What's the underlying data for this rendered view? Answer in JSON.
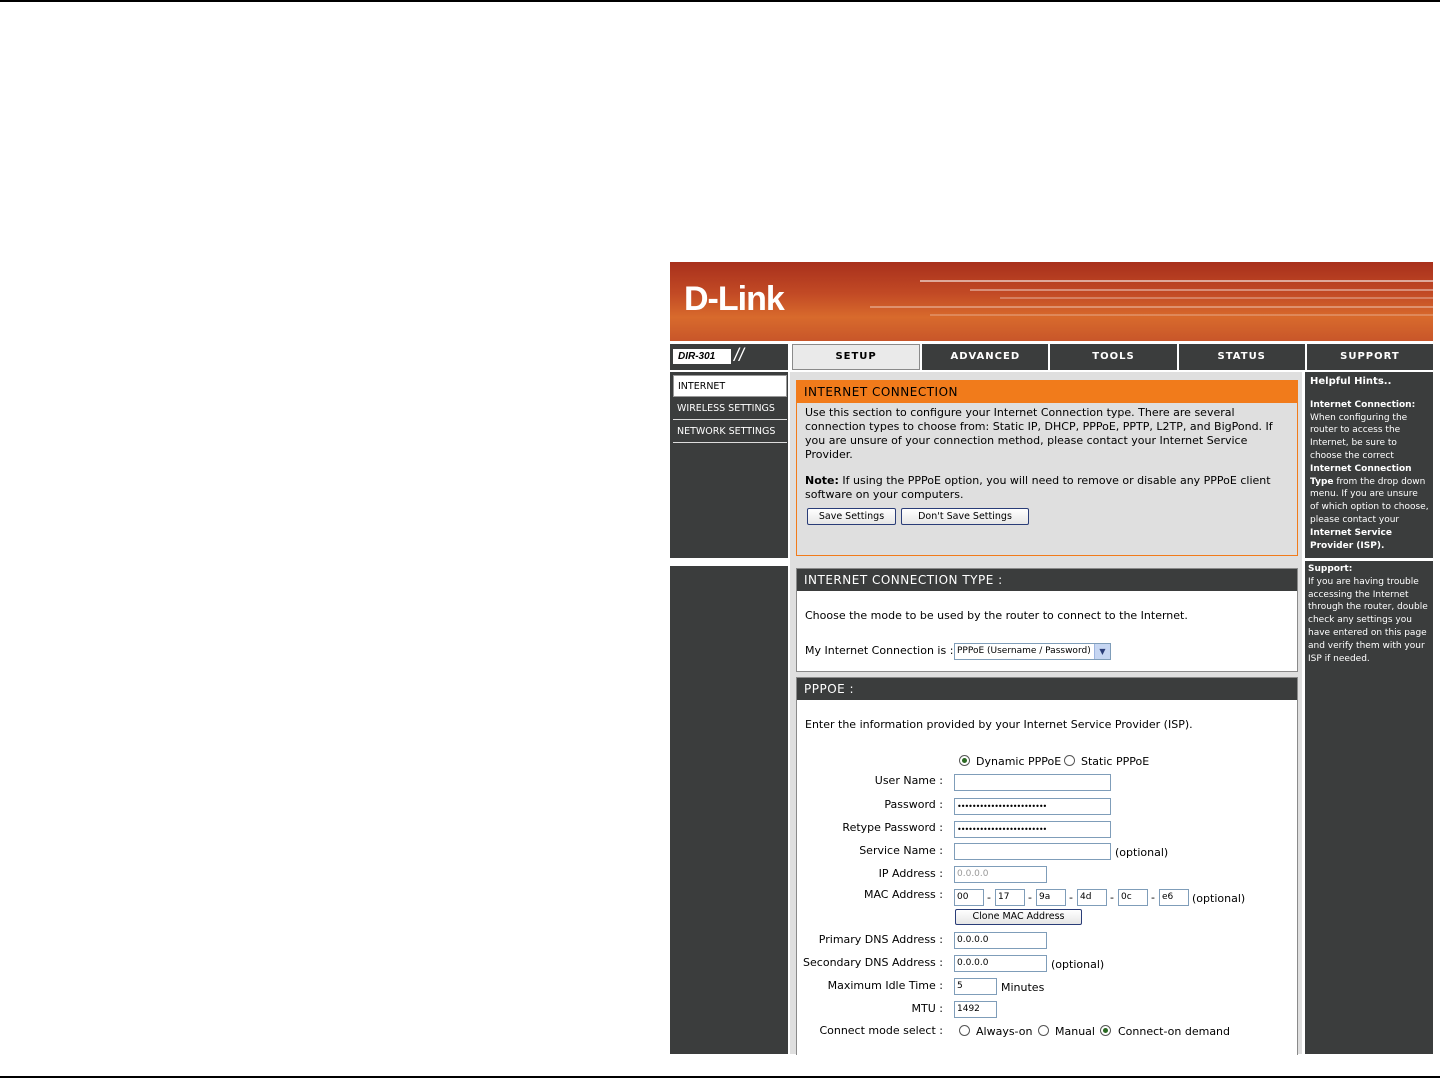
{
  "brand": {
    "logo": "D-Link",
    "model": "DIR-301"
  },
  "tabs": [
    "SETUP",
    "ADVANCED",
    "TOOLS",
    "STATUS",
    "SUPPORT"
  ],
  "nav": [
    "INTERNET",
    "WIRELESS SETTINGS",
    "NETWORK SETTINGS"
  ],
  "intro": {
    "title": "INTERNET CONNECTION",
    "text": "Use this section to configure your Internet Connection type. There are several connection types to choose from: Static IP, DHCP, PPPoE, PPTP, L2TP, and BigPond. If you are unsure of your connection method, please contact your Internet Service Provider.",
    "note_label": "Note:",
    "note_text": "If using the PPPoE option, you will need to remove or disable any PPPoE client software on your computers.",
    "save_label": "Save Settings",
    "dont_save_label": "Don't Save Settings"
  },
  "conn_type": {
    "title": "INTERNET CONNECTION TYPE :",
    "desc": "Choose the mode to be used by the router to connect to the Internet.",
    "label": "My Internet Connection is :",
    "selected": "PPPoE (Username / Password)"
  },
  "pppoe": {
    "title": "PPPOE :",
    "desc": "Enter the information provided by your Internet Service Provider (ISP).",
    "dynamic_label": "Dynamic PPPoE",
    "static_label": "Static PPPoE",
    "user_name_label": "User Name :",
    "user_name": "",
    "password_label": "Password :",
    "password": "••••••••••••••••••••••••",
    "retype_label": "Retype Password :",
    "retype": "••••••••••••••••••••••••",
    "service_label": "Service Name :",
    "service": "",
    "optional": "(optional)",
    "ip_label": "IP Address :",
    "ip": "0.0.0.0",
    "mac_label": "MAC Address :",
    "mac": [
      "00",
      "17",
      "9a",
      "4d",
      "0c",
      "e6"
    ],
    "mac_sep": "-",
    "clone_label": "Clone MAC Address",
    "dns1_label": "Primary DNS Address :",
    "dns1": "0.0.0.0",
    "dns2_label": "Secondary DNS Address :",
    "dns2": "0.0.0.0",
    "idle_label": "Maximum Idle Time :",
    "idle": "5",
    "idle_unit": "Minutes",
    "mtu_label": "MTU :",
    "mtu": "1492",
    "mode_label": "Connect mode select :",
    "mode_always": "Always-on",
    "mode_manual": "Manual",
    "mode_demand": "Connect-on demand"
  },
  "hints": {
    "title": "Helpful Hints..",
    "h1": "Internet Connection:",
    "t1a": "When configuring the router to access the Internet, be sure to choose the correct",
    "t1b": "Internet Connection Type",
    "t1c": "from the drop down menu. If you are unsure of which option to choose, please contact your",
    "t1d": "Internet Service Provider (ISP).",
    "h2": "Support:",
    "t2": "If you are having trouble accessing the Internet through the router, double check any settings you have entered on this page and verify them with your ISP if needed."
  }
}
